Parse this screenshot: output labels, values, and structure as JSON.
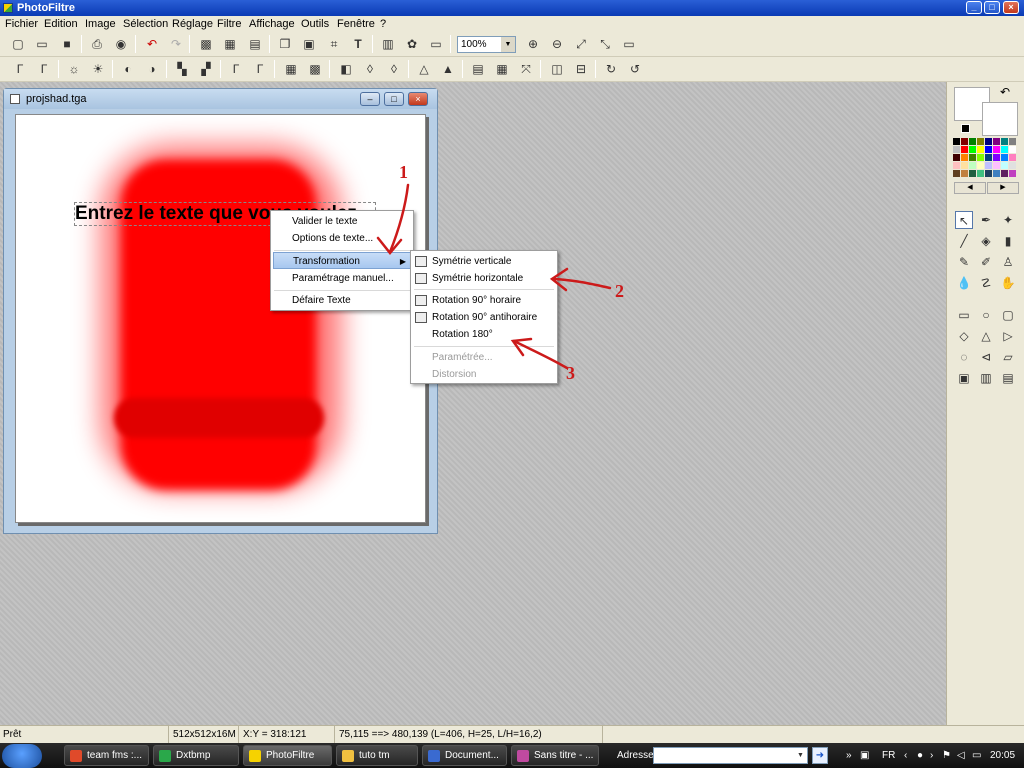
{
  "app": {
    "title": "PhotoFiltre"
  },
  "menubar": [
    "Fichier",
    "Edition",
    "Image",
    "Sélection",
    "Réglage",
    "Filtre",
    "Affichage",
    "Outils",
    "Fenêtre",
    "?"
  ],
  "toolbar": {
    "zoom": "100%"
  },
  "document": {
    "filename": "projshad.tga",
    "canvas_text": "Entrez le texte que vous voulez"
  },
  "context_menu": {
    "items": [
      {
        "label": "Valider le texte"
      },
      {
        "label": "Options de texte..."
      },
      {
        "label": "Transformation",
        "highlighted": true,
        "submenu": true
      },
      {
        "label": "Paramétrage manuel..."
      },
      {
        "label": "Défaire Texte"
      }
    ]
  },
  "submenu": {
    "items": [
      {
        "label": "Symétrie verticale",
        "icon": "flip-vertical-icon"
      },
      {
        "label": "Symétrie horizontale",
        "icon": "flip-horizontal-icon"
      },
      {
        "label": "Rotation 90° horaire",
        "icon": "rotate-cw-icon"
      },
      {
        "label": "Rotation 90° antihoraire",
        "icon": "rotate-ccw-icon"
      },
      {
        "label": "Rotation 180°",
        "icon": ""
      },
      {
        "label": "Paramétrée...",
        "disabled": true
      },
      {
        "label": "Distorsion",
        "disabled": true
      }
    ]
  },
  "annotations": [
    "1",
    "2",
    "3"
  ],
  "statusbar": {
    "status": "Prêt",
    "size": "512x512x16M",
    "coords": "X:Y = 318:121",
    "selection": "75,115 ==> 480,139 (L=406, H=25, L/H=16,2)"
  },
  "taskbar": {
    "tasks": [
      {
        "label": "team fms :...",
        "color": "#e04a2a"
      },
      {
        "label": "Dxtbmp",
        "color": "#2aa84a"
      },
      {
        "label": "PhotoFiltre",
        "color": "#f6d200",
        "active": true
      },
      {
        "label": "tuto tm",
        "color": "#f0c040"
      },
      {
        "label": "Document...",
        "color": "#3a6ad0"
      },
      {
        "label": "Sans titre - ...",
        "color": "#c04aa0"
      }
    ],
    "address_label": "Adresse",
    "address_value": "",
    "lang": "FR",
    "clock": "20:05"
  },
  "colors": {
    "accent": "#2a5fd6",
    "annotation": "#cc1a1a",
    "shape": "#ff0000"
  }
}
